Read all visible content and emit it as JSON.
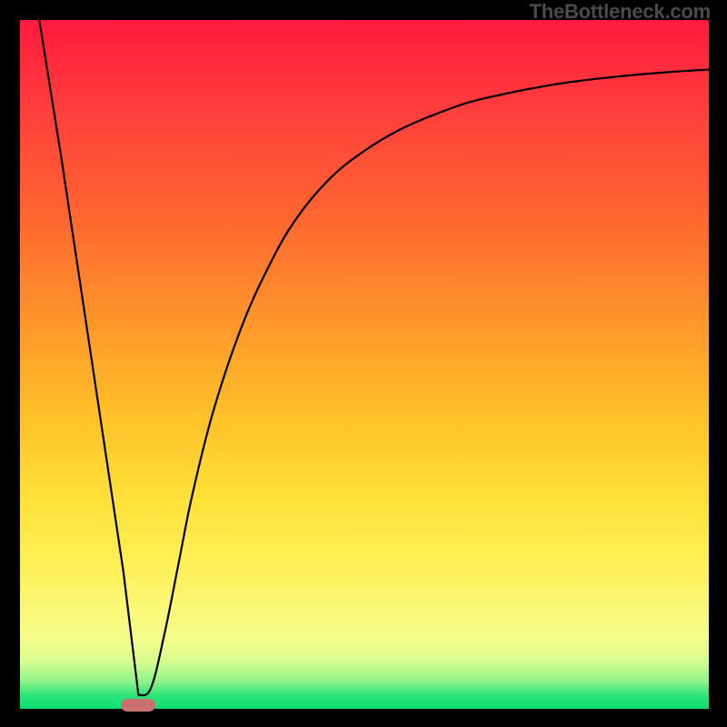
{
  "attribution": "TheBottleneck.com",
  "colors": {
    "bg": "#000000",
    "curve": "#000000",
    "marker": "#cb7070"
  },
  "chart_data": {
    "type": "line",
    "title": "",
    "subtitle": "",
    "xlabel": "",
    "ylabel": "",
    "xlim": [
      0,
      1
    ],
    "ylim": [
      0,
      1
    ],
    "legend": false,
    "grid": false,
    "annotations": [
      "TheBottleneck.com"
    ],
    "series": [
      {
        "name": "curve",
        "x": [
          0.028,
          0.06,
          0.09,
          0.12,
          0.15,
          0.172,
          0.19,
          0.21,
          0.23,
          0.25,
          0.28,
          0.32,
          0.36,
          0.4,
          0.45,
          0.5,
          0.55,
          0.6,
          0.65,
          0.7,
          0.75,
          0.8,
          0.85,
          0.9,
          0.95,
          1.0
        ],
        "y": [
          1.0,
          0.8,
          0.6,
          0.4,
          0.2,
          0.02,
          0.03,
          0.11,
          0.21,
          0.31,
          0.43,
          0.55,
          0.64,
          0.71,
          0.77,
          0.81,
          0.84,
          0.862,
          0.88,
          0.892,
          0.902,
          0.91,
          0.916,
          0.921,
          0.925,
          0.928
        ]
      }
    ],
    "marker": {
      "x": 0.172,
      "y": 0.005
    },
    "gradient_colors_top_to_bottom": [
      "#ff1a3d",
      "#ff6a2f",
      "#ffc228",
      "#fdf15a",
      "#8ef58b",
      "#0adf70"
    ]
  }
}
